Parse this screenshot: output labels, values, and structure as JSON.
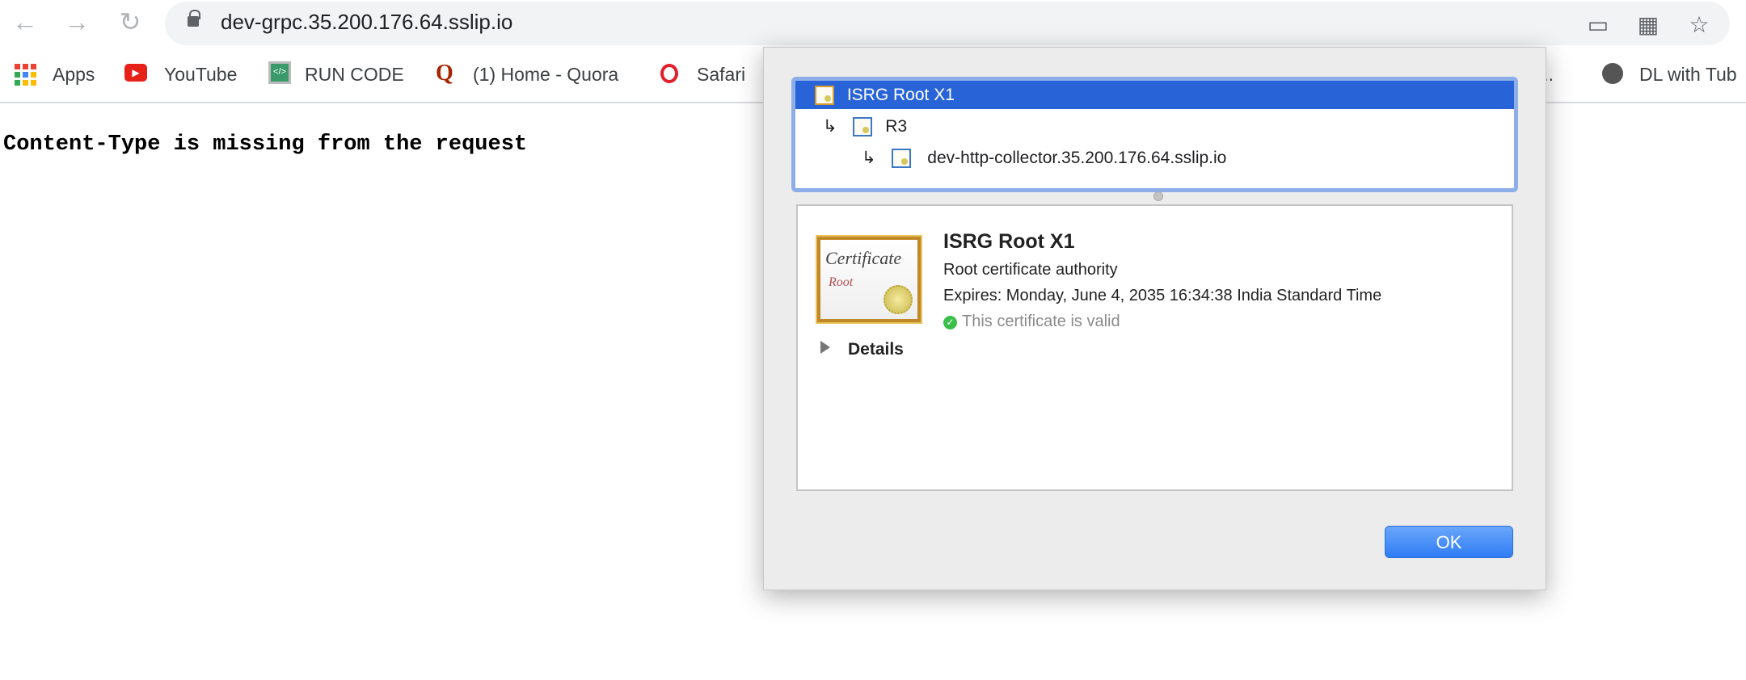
{
  "browser": {
    "url": "dev-grpc.35.200.176.64.sslip.io",
    "nav_icons": [
      "back-arrow-icon",
      "forward-arrow-icon",
      "reload-icon"
    ],
    "right_icons": [
      "cast-icon",
      "extension-icon",
      "bookmark-star-icon"
    ]
  },
  "bookmarks": [
    {
      "label": "Apps",
      "icon": "apps-grid-icon"
    },
    {
      "label": "YouTube",
      "icon": "youtube-icon"
    },
    {
      "label": "RUN CODE",
      "icon": "run-code-icon"
    },
    {
      "label": "(1) Home - Quora",
      "icon": "quora-icon"
    },
    {
      "label": "Safari",
      "icon": "opera-icon"
    },
    {
      "label": "G...",
      "icon": ""
    },
    {
      "label": "DL with Tub",
      "icon": "globe-icon"
    }
  ],
  "page": {
    "message": "Content-Type is missing from the request"
  },
  "dialog": {
    "tree": [
      {
        "label": "ISRG Root X1",
        "selected": true
      },
      {
        "label": "R3",
        "selected": false
      },
      {
        "label": "dev-http-collector.35.200.176.64.sslip.io",
        "selected": false
      }
    ],
    "arrow": "↳",
    "cert_image": {
      "script": "Certificate",
      "sub": "Root"
    },
    "detail": {
      "title": "ISRG Root X1",
      "subtitle": "Root certificate authority",
      "expires": "Expires: Monday, June 4, 2035 16:34:38 India Standard Time",
      "status": "This certificate is valid",
      "status_color": "#3cbf4a",
      "details_label": "Details"
    },
    "ok_label": "OK",
    "accent": "#2864d8"
  }
}
